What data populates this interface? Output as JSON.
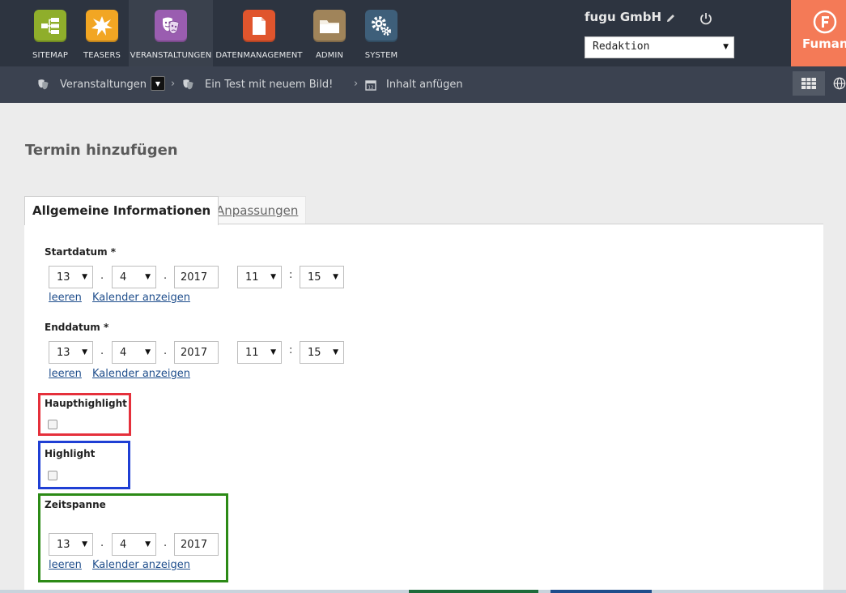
{
  "nav": {
    "items": [
      {
        "label": "SITEMAP",
        "icon": "sitemap-icon",
        "color": "#8fae2b"
      },
      {
        "label": "TEASERS",
        "icon": "burst-icon",
        "color": "#f2a623"
      },
      {
        "label": "VERANSTALTUNGEN",
        "icon": "theater-masks-icon",
        "color": "#9a5db0"
      },
      {
        "label": "DATENMANAGEMENT",
        "icon": "document-icon",
        "color": "#e0552d"
      },
      {
        "label": "ADMIN",
        "icon": "folder-icon",
        "color": "#a0845a"
      },
      {
        "label": "SYSTEM",
        "icon": "gears-icon",
        "color": "#3e5f7a"
      }
    ]
  },
  "header": {
    "company": "fugu GmbH",
    "role_selected": "Redaktion",
    "brand_text": "Fuman"
  },
  "breadcrumb": {
    "items": [
      "Veranstaltungen",
      "Ein Test mit neuem Bild!",
      "Inhalt anfügen"
    ]
  },
  "page": {
    "title": "Termin hinzufügen",
    "tabs": [
      "Allgemeine Informationen",
      "Anpassungen"
    ]
  },
  "form": {
    "start": {
      "label": "Startdatum *",
      "day": "13",
      "month": "4",
      "year": "2017",
      "hour": "11",
      "minute": "15"
    },
    "end": {
      "label": "Enddatum *",
      "day": "13",
      "month": "4",
      "year": "2017",
      "hour": "11",
      "minute": "15"
    },
    "main_highlight": {
      "label": "Haupthighlight",
      "checked": false
    },
    "highlight": {
      "label": "Highlight",
      "checked": false
    },
    "span": {
      "label": "Zeitspanne",
      "day": "13",
      "month": "4",
      "year": "2017"
    },
    "clear_link": "leeren",
    "calendar_link": "Kalender anzeigen",
    "date_sep": ".",
    "time_sep": ":"
  },
  "annotations": {
    "red": "#e5303b",
    "blue": "#1f3fd4",
    "green": "#2c8a16"
  }
}
